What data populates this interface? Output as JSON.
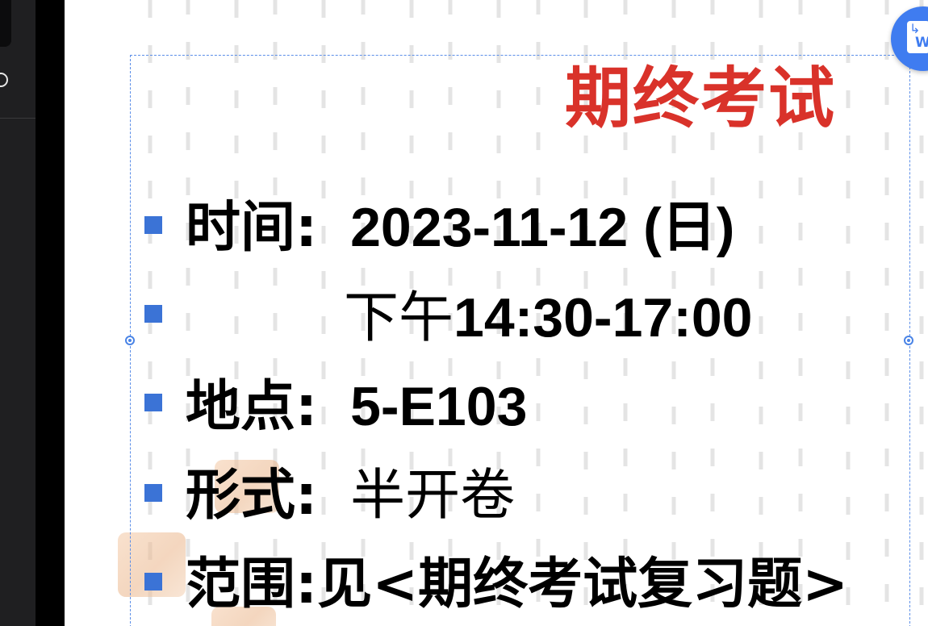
{
  "slide": {
    "title": "期终考试",
    "items": [
      {
        "key": "时间:",
        "value": "2023-11-12 (日)"
      },
      {
        "key": "",
        "value_cjk": "下午",
        "value": "14:30-17:00"
      },
      {
        "key": "地点:",
        "value": "5-E103"
      },
      {
        "key": "形式:",
        "value_cjk": "半开卷"
      },
      {
        "key": "范围:",
        "value_cjk": "见<期终考试复习题>"
      }
    ]
  },
  "colors": {
    "title": "#d9322a",
    "bullet": "#3b73d6",
    "selection": "#5b8ee8",
    "fab": "#3f7cf0",
    "sidebar": "#1f1f21"
  },
  "icons": {
    "fab": "convert-to-word-icon",
    "sidebar": "search-icon"
  }
}
